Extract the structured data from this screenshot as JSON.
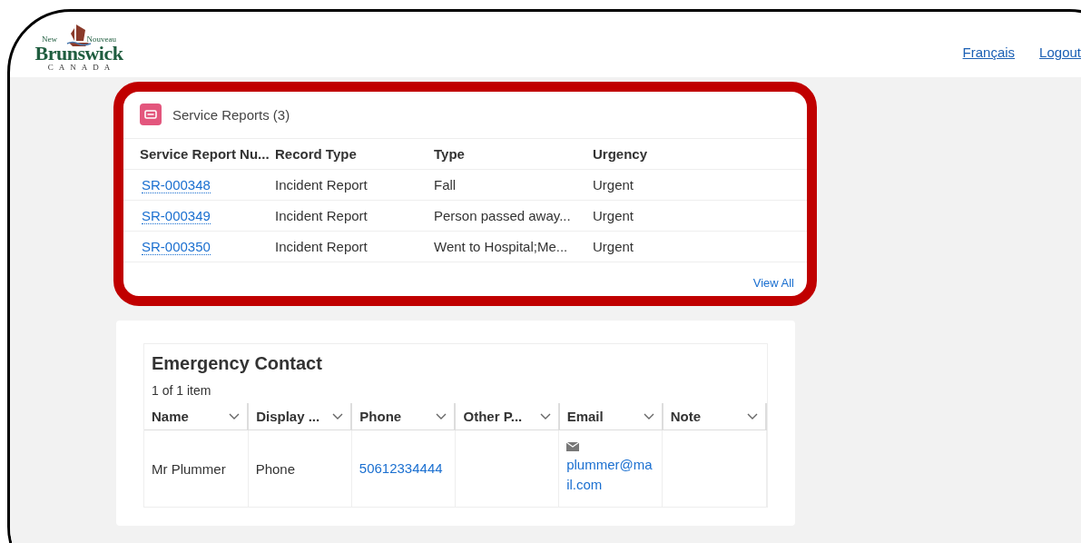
{
  "header": {
    "logo": {
      "word_left": "New",
      "word_right": "Nouveau",
      "name": "Brunswick",
      "country": "CANADA"
    },
    "links": [
      "Français",
      "Logout"
    ]
  },
  "service_reports": {
    "title": "Service Reports (3)",
    "highlighted": true,
    "columns": [
      "Service Report Nu...",
      "Record Type",
      "Type",
      "Urgency"
    ],
    "rows": [
      {
        "number": "SR-000348",
        "record_type": "Incident Report",
        "type": "Fall",
        "urgency": "Urgent"
      },
      {
        "number": "SR-000349",
        "record_type": "Incident Report",
        "type": "Person passed away...",
        "urgency": "Urgent"
      },
      {
        "number": "SR-000350",
        "record_type": "Incident Report",
        "type": "Went to Hospital;Me...",
        "urgency": "Urgent"
      }
    ],
    "view_all": "View All"
  },
  "emergency_contact": {
    "title": "Emergency Contact",
    "count": "1 of 1 item",
    "columns": [
      "Name",
      "Display ...",
      "Phone",
      "Other P...",
      "Email",
      "Note"
    ],
    "rows": [
      {
        "name": "Mr Plummer",
        "display": "Phone",
        "phone": "50612334444",
        "email": "plummer@mail.com"
      }
    ]
  }
}
